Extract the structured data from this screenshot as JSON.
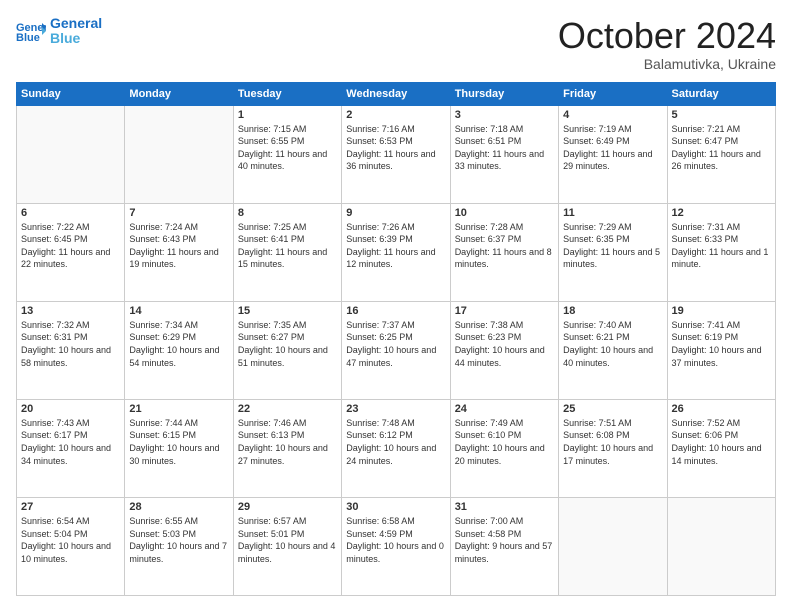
{
  "header": {
    "logo_line1": "General",
    "logo_line2": "Blue",
    "month": "October 2024",
    "location": "Balamutivka, Ukraine"
  },
  "weekdays": [
    "Sunday",
    "Monday",
    "Tuesday",
    "Wednesday",
    "Thursday",
    "Friday",
    "Saturday"
  ],
  "weeks": [
    [
      {
        "day": "",
        "empty": true
      },
      {
        "day": "",
        "empty": true
      },
      {
        "day": "1",
        "sunrise": "7:15 AM",
        "sunset": "6:55 PM",
        "daylight": "11 hours and 40 minutes."
      },
      {
        "day": "2",
        "sunrise": "7:16 AM",
        "sunset": "6:53 PM",
        "daylight": "11 hours and 36 minutes."
      },
      {
        "day": "3",
        "sunrise": "7:18 AM",
        "sunset": "6:51 PM",
        "daylight": "11 hours and 33 minutes."
      },
      {
        "day": "4",
        "sunrise": "7:19 AM",
        "sunset": "6:49 PM",
        "daylight": "11 hours and 29 minutes."
      },
      {
        "day": "5",
        "sunrise": "7:21 AM",
        "sunset": "6:47 PM",
        "daylight": "11 hours and 26 minutes."
      }
    ],
    [
      {
        "day": "6",
        "sunrise": "7:22 AM",
        "sunset": "6:45 PM",
        "daylight": "11 hours and 22 minutes."
      },
      {
        "day": "7",
        "sunrise": "7:24 AM",
        "sunset": "6:43 PM",
        "daylight": "11 hours and 19 minutes."
      },
      {
        "day": "8",
        "sunrise": "7:25 AM",
        "sunset": "6:41 PM",
        "daylight": "11 hours and 15 minutes."
      },
      {
        "day": "9",
        "sunrise": "7:26 AM",
        "sunset": "6:39 PM",
        "daylight": "11 hours and 12 minutes."
      },
      {
        "day": "10",
        "sunrise": "7:28 AM",
        "sunset": "6:37 PM",
        "daylight": "11 hours and 8 minutes."
      },
      {
        "day": "11",
        "sunrise": "7:29 AM",
        "sunset": "6:35 PM",
        "daylight": "11 hours and 5 minutes."
      },
      {
        "day": "12",
        "sunrise": "7:31 AM",
        "sunset": "6:33 PM",
        "daylight": "11 hours and 1 minute."
      }
    ],
    [
      {
        "day": "13",
        "sunrise": "7:32 AM",
        "sunset": "6:31 PM",
        "daylight": "10 hours and 58 minutes."
      },
      {
        "day": "14",
        "sunrise": "7:34 AM",
        "sunset": "6:29 PM",
        "daylight": "10 hours and 54 minutes."
      },
      {
        "day": "15",
        "sunrise": "7:35 AM",
        "sunset": "6:27 PM",
        "daylight": "10 hours and 51 minutes."
      },
      {
        "day": "16",
        "sunrise": "7:37 AM",
        "sunset": "6:25 PM",
        "daylight": "10 hours and 47 minutes."
      },
      {
        "day": "17",
        "sunrise": "7:38 AM",
        "sunset": "6:23 PM",
        "daylight": "10 hours and 44 minutes."
      },
      {
        "day": "18",
        "sunrise": "7:40 AM",
        "sunset": "6:21 PM",
        "daylight": "10 hours and 40 minutes."
      },
      {
        "day": "19",
        "sunrise": "7:41 AM",
        "sunset": "6:19 PM",
        "daylight": "10 hours and 37 minutes."
      }
    ],
    [
      {
        "day": "20",
        "sunrise": "7:43 AM",
        "sunset": "6:17 PM",
        "daylight": "10 hours and 34 minutes."
      },
      {
        "day": "21",
        "sunrise": "7:44 AM",
        "sunset": "6:15 PM",
        "daylight": "10 hours and 30 minutes."
      },
      {
        "day": "22",
        "sunrise": "7:46 AM",
        "sunset": "6:13 PM",
        "daylight": "10 hours and 27 minutes."
      },
      {
        "day": "23",
        "sunrise": "7:48 AM",
        "sunset": "6:12 PM",
        "daylight": "10 hours and 24 minutes."
      },
      {
        "day": "24",
        "sunrise": "7:49 AM",
        "sunset": "6:10 PM",
        "daylight": "10 hours and 20 minutes."
      },
      {
        "day": "25",
        "sunrise": "7:51 AM",
        "sunset": "6:08 PM",
        "daylight": "10 hours and 17 minutes."
      },
      {
        "day": "26",
        "sunrise": "7:52 AM",
        "sunset": "6:06 PM",
        "daylight": "10 hours and 14 minutes."
      }
    ],
    [
      {
        "day": "27",
        "sunrise": "6:54 AM",
        "sunset": "5:04 PM",
        "daylight": "10 hours and 10 minutes."
      },
      {
        "day": "28",
        "sunrise": "6:55 AM",
        "sunset": "5:03 PM",
        "daylight": "10 hours and 7 minutes."
      },
      {
        "day": "29",
        "sunrise": "6:57 AM",
        "sunset": "5:01 PM",
        "daylight": "10 hours and 4 minutes."
      },
      {
        "day": "30",
        "sunrise": "6:58 AM",
        "sunset": "4:59 PM",
        "daylight": "10 hours and 0 minutes."
      },
      {
        "day": "31",
        "sunrise": "7:00 AM",
        "sunset": "4:58 PM",
        "daylight": "9 hours and 57 minutes."
      },
      {
        "day": "",
        "empty": true
      },
      {
        "day": "",
        "empty": true
      }
    ]
  ]
}
